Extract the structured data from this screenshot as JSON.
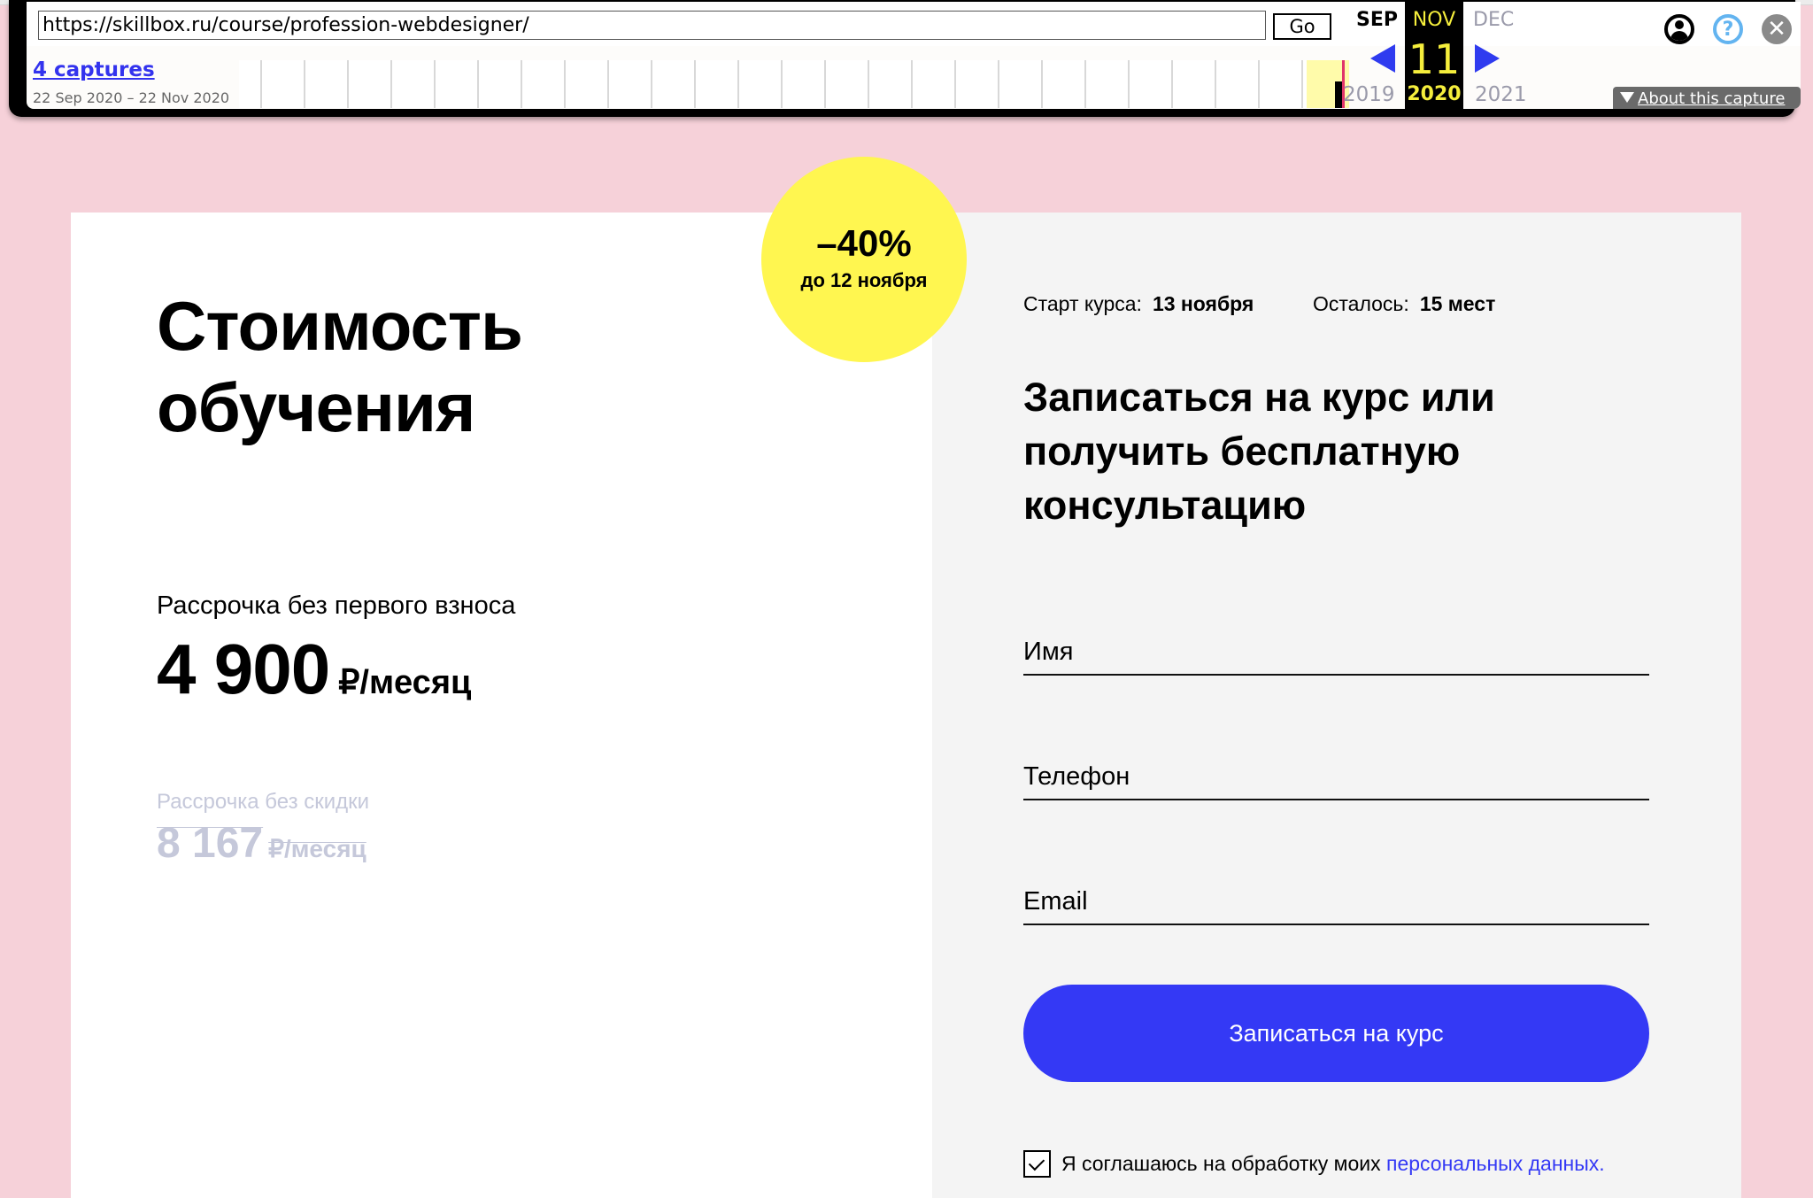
{
  "wayback": {
    "url": "https://skillbox.ru/course/profession-webdesigner/",
    "go_label": "Go",
    "captures_label": "4 captures",
    "date_range": "22 Sep 2020 – 22 Nov 2020",
    "calendar": {
      "prev_month": "SEP",
      "current_month": "NOV",
      "next_month": "DEC",
      "current_day": "11",
      "prev_year": "2019",
      "current_year": "2020",
      "next_year": "2021"
    },
    "icons": {
      "user": "user-account-icon",
      "help": "?",
      "close": "✕"
    },
    "about_label": "About this capture",
    "colors": {
      "highlight": "#f5ee3c",
      "arrow": "#2f3bef",
      "link": "#3333ee"
    }
  },
  "pricing": {
    "title_line1": "Стоимость",
    "title_line2": "обучения",
    "installment_label": "Рассрочка без первого взноса",
    "price_value": "4 900",
    "price_unit": "₽/месяц",
    "old_label": "Рассрочка без скидки",
    "old_price_value": "8 167",
    "old_price_unit": "₽/месяц"
  },
  "badge": {
    "discount": "–40%",
    "until": "до 12 ноября",
    "color": "#fff650"
  },
  "signup": {
    "start_label": "Старт курса:",
    "start_value": "13 ноября",
    "seats_label": "Осталось:",
    "seats_value": "15 мест",
    "title": "Записаться на курс или получить бесплатную консультацию",
    "fields": {
      "name_placeholder": "Имя",
      "phone_placeholder": "Телефон",
      "email_placeholder": "Email",
      "name_value": "",
      "phone_value": "",
      "email_value": ""
    },
    "submit_label": "Записаться на курс",
    "consent_checked": true,
    "consent_text": "Я соглашаюсь на обработку моих",
    "consent_link": "персональных данных.",
    "accent_color": "#3439f5"
  }
}
